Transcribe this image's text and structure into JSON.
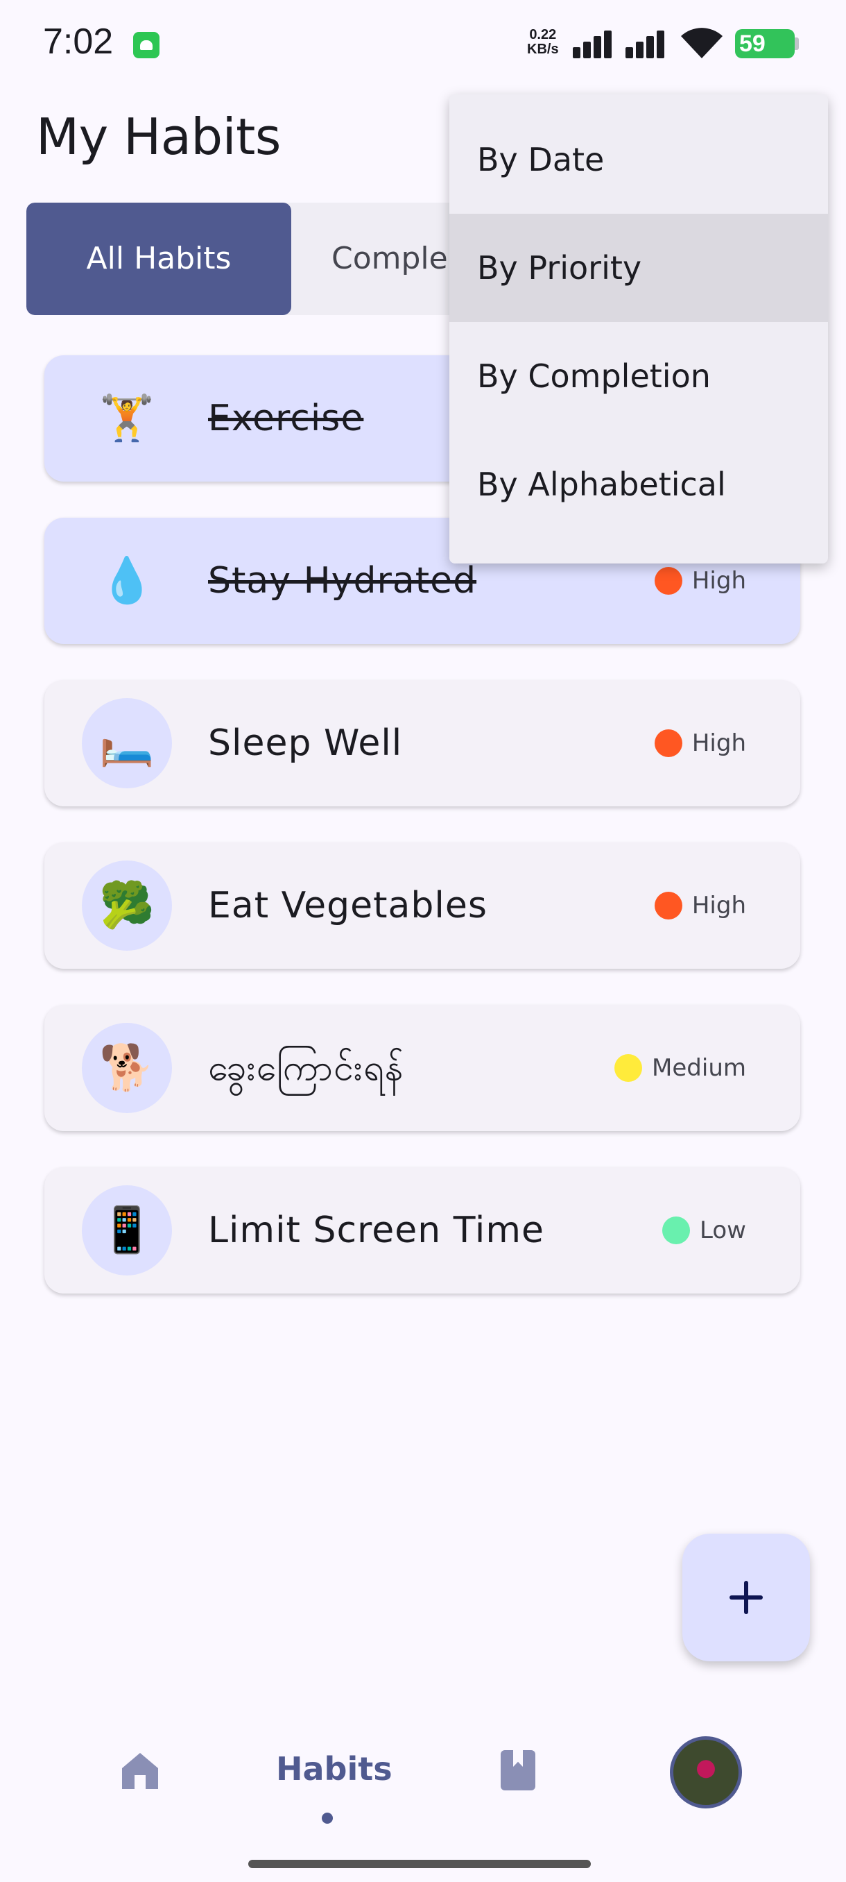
{
  "status_bar": {
    "time": "7:02",
    "net_speed_value": "0.22",
    "net_speed_unit": "KB/s",
    "battery": "59"
  },
  "page": {
    "title": "My Habits"
  },
  "tabs": [
    {
      "label": "All Habits",
      "active": true
    },
    {
      "label": "Comple",
      "active": false
    }
  ],
  "habits": [
    {
      "emoji": "🏋️",
      "name": "Exercise",
      "completed": true,
      "priority": "",
      "priority_color": ""
    },
    {
      "emoji": "💧",
      "name": "Stay Hydrated",
      "completed": true,
      "priority": "High",
      "priority_color": "#FF5722"
    },
    {
      "emoji": "🛏️",
      "name": "Sleep Well",
      "completed": false,
      "priority": "High",
      "priority_color": "#FF5722"
    },
    {
      "emoji": "🥦",
      "name": "Eat Vegetables",
      "completed": false,
      "priority": "High",
      "priority_color": "#FF5722"
    },
    {
      "emoji": "🐕",
      "name": "ခွေးကြောင်းရန်",
      "completed": false,
      "priority": "Medium",
      "priority_color": "#FFEB3B"
    },
    {
      "emoji": "📱",
      "name": "Limit Screen Time",
      "completed": false,
      "priority": "Low",
      "priority_color": "#69F0AE"
    }
  ],
  "sort_menu": {
    "items": [
      "By Date",
      "By Priority",
      "By Completion",
      "By Alphabetical"
    ],
    "highlighted": "By Priority"
  },
  "bottom_nav": {
    "home_icon": "home-icon",
    "habits_label": "Habits",
    "journal_icon": "book-icon"
  },
  "colors": {
    "accent": "#505A90",
    "card_done": "#DEE0FF",
    "card": "#F4F1F8"
  }
}
